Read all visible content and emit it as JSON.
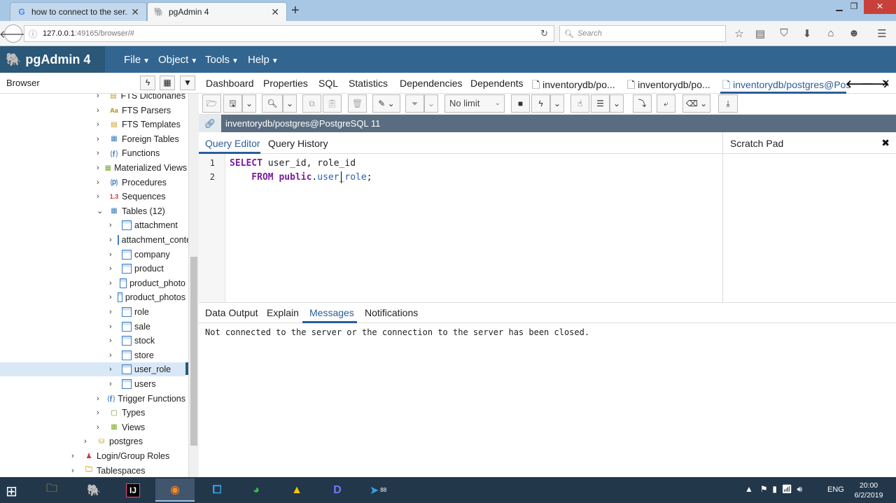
{
  "browser": {
    "tabs": [
      {
        "title": "how to connect to the ser...",
        "favicon": "G"
      },
      {
        "title": "pgAdmin 4",
        "favicon": "elephant"
      }
    ],
    "url_host": "127.0.0.1",
    "url_path": ":49165/browser/#",
    "search_placeholder": "Search"
  },
  "app": {
    "name": "pgAdmin 4",
    "menus": [
      "File",
      "Object",
      "Tools",
      "Help"
    ]
  },
  "browser_panel": {
    "title": "Browser",
    "tree": [
      {
        "label": "FTS Dictionaries",
        "indent": 1,
        "icon": "fts-dictionary-icon"
      },
      {
        "label": "FTS Parsers",
        "indent": 1,
        "icon": "fts-parser-icon",
        "glyph": "Aa"
      },
      {
        "label": "FTS Templates",
        "indent": 1,
        "icon": "fts-template-icon"
      },
      {
        "label": "Foreign Tables",
        "indent": 1,
        "icon": "foreign-table-icon"
      },
      {
        "label": "Functions",
        "indent": 1,
        "icon": "function-icon"
      },
      {
        "label": "Materialized Views",
        "indent": 1,
        "icon": "materialized-view-icon"
      },
      {
        "label": "Procedures",
        "indent": 1,
        "icon": "procedure-icon"
      },
      {
        "label": "Sequences",
        "indent": 1,
        "icon": "sequence-icon",
        "glyph": "1.3"
      },
      {
        "label": "Tables (12)",
        "indent": 1,
        "icon": "tables-icon",
        "expanded": true
      },
      {
        "label": "attachment",
        "indent": 2,
        "icon": "table-icon"
      },
      {
        "label": "attachment_conte",
        "indent": 2,
        "icon": "table-icon"
      },
      {
        "label": "company",
        "indent": 2,
        "icon": "table-icon"
      },
      {
        "label": "product",
        "indent": 2,
        "icon": "table-icon"
      },
      {
        "label": "product_photo",
        "indent": 2,
        "icon": "table-icon"
      },
      {
        "label": "product_photos",
        "indent": 2,
        "icon": "table-icon"
      },
      {
        "label": "role",
        "indent": 2,
        "icon": "table-icon"
      },
      {
        "label": "sale",
        "indent": 2,
        "icon": "table-icon"
      },
      {
        "label": "stock",
        "indent": 2,
        "icon": "table-icon"
      },
      {
        "label": "store",
        "indent": 2,
        "icon": "table-icon"
      },
      {
        "label": "user_role",
        "indent": 2,
        "icon": "table-icon",
        "selected": true
      },
      {
        "label": "users",
        "indent": 2,
        "icon": "table-icon"
      },
      {
        "label": "Trigger Functions",
        "indent": 1,
        "icon": "trigger-function-icon"
      },
      {
        "label": "Types",
        "indent": 1,
        "icon": "type-icon"
      },
      {
        "label": "Views",
        "indent": 1,
        "icon": "view-icon"
      },
      {
        "label": "postgres",
        "indent": 0,
        "icon": "database-icon"
      },
      {
        "label": "Login/Group Roles",
        "indent": -1,
        "icon": "login-role-icon"
      },
      {
        "label": "Tablespaces",
        "indent": -1,
        "icon": "tablespace-icon"
      }
    ]
  },
  "main_tabs": [
    {
      "label": "Dashboard"
    },
    {
      "label": "Properties"
    },
    {
      "label": "SQL"
    },
    {
      "label": "Statistics"
    },
    {
      "label": "Dependencies"
    },
    {
      "label": "Dependents"
    },
    {
      "label": "inventorydb/po...",
      "doc": true
    },
    {
      "label": "inventorydb/po...",
      "doc": true
    },
    {
      "label": "inventorydb/postgres@Pos",
      "doc": true,
      "active": true
    }
  ],
  "query_tool": {
    "limit_select": "No limit",
    "connection": "inventorydb/postgres@PostgreSQL 11",
    "editor_tabs": [
      "Query Editor",
      "Query History"
    ],
    "editor_lines": [
      {
        "number": "1",
        "tokens": [
          {
            "t": "SELECT",
            "k": "kw"
          },
          {
            "t": " user_id, role_id",
            "k": "plain"
          }
        ]
      },
      {
        "number": "2",
        "tokens": [
          {
            "t": "    FROM",
            "k": "kw"
          },
          {
            "t": " ",
            "k": "plain"
          },
          {
            "t": "public",
            "k": "kw"
          },
          {
            "t": ".",
            "k": "plain"
          },
          {
            "t": "user_role",
            "k": "idf"
          },
          {
            "t": ";",
            "k": "plain"
          }
        ]
      }
    ],
    "scratch_pad_title": "Scratch Pad",
    "output_tabs": [
      "Data Output",
      "Explain",
      "Messages",
      "Notifications"
    ],
    "active_output_tab": "Messages",
    "message": "Not connected to the server or the connection to the server has been closed."
  },
  "taskbar": {
    "language": "ENG",
    "time": "20:00",
    "date": "6/2/2019",
    "telegram_badge": "88"
  }
}
